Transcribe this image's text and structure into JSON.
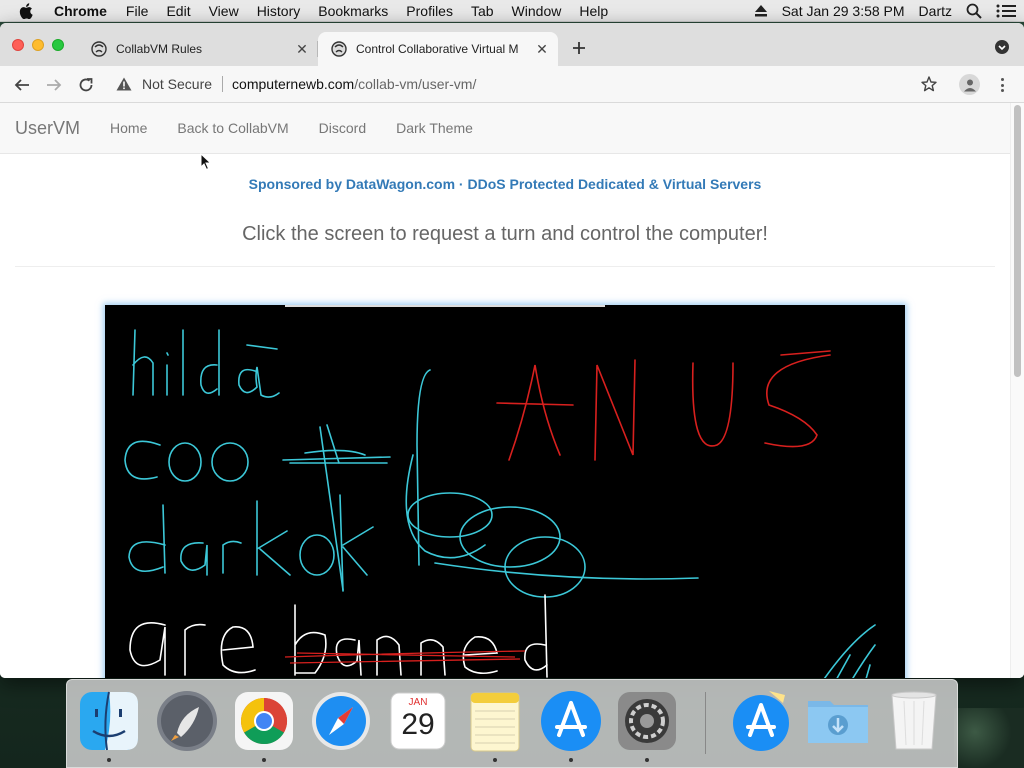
{
  "menubar": {
    "app_name": "Chrome",
    "menus": [
      "File",
      "Edit",
      "View",
      "History",
      "Bookmarks",
      "Profiles",
      "Tab",
      "Window",
      "Help"
    ],
    "clock": "Sat Jan 29  3:58 PM",
    "user": "Dartz"
  },
  "tabs": [
    {
      "title": "CollabVM Rules",
      "active": false,
      "icon": "collabvm-favicon-icon"
    },
    {
      "title": "Control Collaborative Virtual M",
      "active": true,
      "icon": "collabvm-favicon-icon"
    }
  ],
  "toolbar": {
    "security_label": "Not Secure",
    "url_host": "computernewb.com",
    "url_path": "/collab-vm/user-vm/"
  },
  "site": {
    "brand": "UserVM",
    "nav": [
      "Home",
      "Back to CollabVM",
      "Discord",
      "Dark Theme"
    ],
    "sponsor": "Sponsored by DataWagon.com · DDoS Protected Dedicated & Virtual Servers",
    "instructions": "Click the screen to request a turn and control the computer!",
    "vm_screen_drawing_text": [
      "hilda",
      "coo",
      "darkok",
      "are banned",
      "ANUS"
    ]
  },
  "dock": {
    "items": [
      "Finder",
      "Launchpad",
      "Google Chrome",
      "Safari",
      "Calendar",
      "Notes",
      "App Store",
      "System Preferences",
      "App Store",
      "Downloads",
      "Trash"
    ],
    "calendar_month": "JAN",
    "calendar_day": "29"
  },
  "colors": {
    "link_blue": "#337ab7",
    "vm_glow": "#66afe9",
    "drawing_cyan": "#3cc8d8",
    "drawing_red": "#d8201e",
    "drawing_white": "#ffffff"
  }
}
